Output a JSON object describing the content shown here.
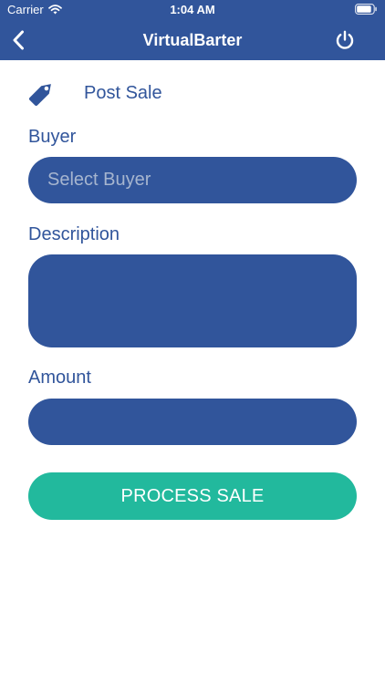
{
  "status_bar": {
    "carrier": "Carrier",
    "time": "1:04 AM",
    "icons": [
      "wifi-icon",
      "battery-icon"
    ]
  },
  "nav_bar": {
    "title": "VirtualBarter",
    "back_icon": "chevron-left-icon",
    "power_icon": "power-icon"
  },
  "page": {
    "title": "Post Sale",
    "icon": "tag-icon"
  },
  "form": {
    "buyer_label": "Buyer",
    "buyer_placeholder": "Select Buyer",
    "description_label": "Description",
    "description_value": "",
    "amount_label": "Amount",
    "amount_value": "",
    "submit_label": "PROCESS SALE"
  },
  "colors": {
    "primary": "#31559b",
    "accent": "#22b99d",
    "background": "#ffffff",
    "placeholder": "#a6b5cf"
  }
}
